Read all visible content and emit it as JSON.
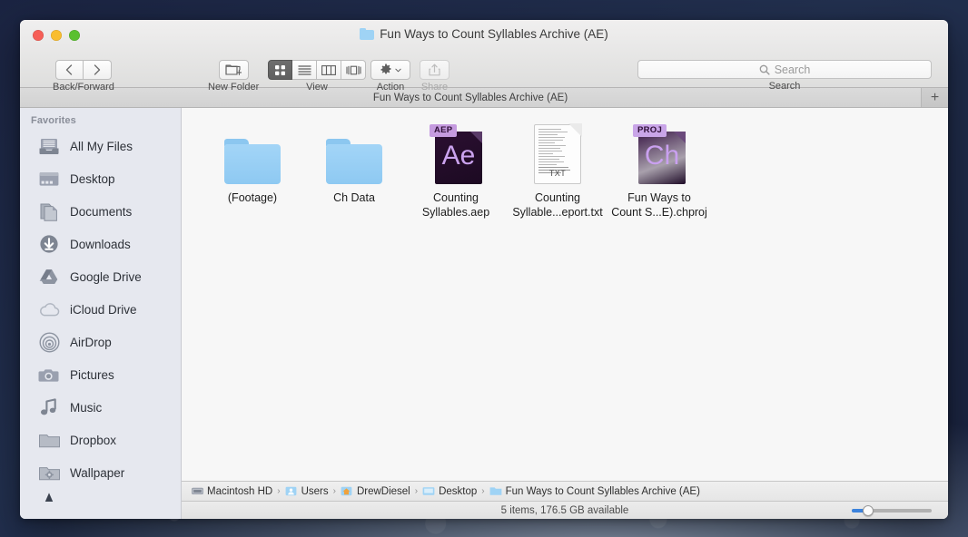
{
  "window": {
    "title": "Fun Ways to Count Syllables Archive (AE)",
    "folder_icon": "folder-icon",
    "traffic_lights": {
      "close": "close-window-button",
      "minimize": "minimize-window-button",
      "zoom": "zoom-window-button"
    }
  },
  "toolbar": {
    "back_label": "‹",
    "forward_label": "›",
    "nav_caption": "Back/Forward",
    "new_folder_caption": "New Folder",
    "view_caption": "View",
    "action_caption": "Action",
    "share_caption": "Share",
    "search_caption": "Search",
    "view_modes": [
      {
        "name": "icon-view",
        "selected": true
      },
      {
        "name": "list-view",
        "selected": false
      },
      {
        "name": "column-view",
        "selected": false
      },
      {
        "name": "coverflow-view",
        "selected": false
      }
    ]
  },
  "search": {
    "placeholder": "Search",
    "value": "",
    "icon": "search-icon"
  },
  "tabbar": {
    "active_tab": "Fun Ways to Count Syllables Archive (AE)",
    "add_tab_label": "+"
  },
  "sidebar": {
    "header": "Favorites",
    "items": [
      {
        "label": "All My Files",
        "icon": "all-my-files-icon"
      },
      {
        "label": "Desktop",
        "icon": "desktop-icon"
      },
      {
        "label": "Documents",
        "icon": "documents-icon"
      },
      {
        "label": "Downloads",
        "icon": "downloads-icon"
      },
      {
        "label": "Google Drive",
        "icon": "google-drive-icon"
      },
      {
        "label": "iCloud Drive",
        "icon": "icloud-drive-icon"
      },
      {
        "label": "AirDrop",
        "icon": "airdrop-icon"
      },
      {
        "label": "Pictures",
        "icon": "pictures-icon"
      },
      {
        "label": "Music",
        "icon": "music-icon"
      },
      {
        "label": "Dropbox",
        "icon": "dropbox-folder-icon"
      },
      {
        "label": "Wallpaper",
        "icon": "wallpaper-folder-icon"
      }
    ]
  },
  "files": [
    {
      "name": "(Footage)",
      "line1": "(Footage)",
      "line2": "",
      "kind": "folder",
      "icon": "folder-icon"
    },
    {
      "name": "Ch Data",
      "line1": "Ch Data",
      "line2": "",
      "kind": "folder",
      "icon": "folder-icon"
    },
    {
      "name": "Counting Syllables.aep",
      "line1": "Counting",
      "line2": "Syllables.aep",
      "kind": "after-effects-project",
      "icon": "after-effects-file-icon",
      "badge": "AEP",
      "glyph": "Ae",
      "badge_color": "#c59bdf",
      "glyph_color": "#cba3ef",
      "body_color": "#22092a"
    },
    {
      "name": "Counting Syllable...eport.txt",
      "line1": "Counting",
      "line2": "Syllable...eport.txt",
      "kind": "plain-text-document",
      "icon": "text-file-icon",
      "badge": "TXT"
    },
    {
      "name": "Fun Ways to Count S...E).chproj",
      "line1": "Fun Ways to",
      "line2": "Count S...E).chproj",
      "kind": "character-animator-project",
      "icon": "character-animator-file-icon",
      "badge": "PROJ",
      "glyph": "Ch",
      "badge_color": "#c9a5e8",
      "glyph_color": "#c9a0ef",
      "body_color": "#2d123a"
    }
  ],
  "pathbar": {
    "crumbs": [
      {
        "label": "Macintosh HD",
        "icon": "hard-drive-icon"
      },
      {
        "label": "Users",
        "icon": "users-folder-icon"
      },
      {
        "label": "DrewDiesel",
        "icon": "home-folder-icon"
      },
      {
        "label": "Desktop",
        "icon": "desktop-folder-icon"
      },
      {
        "label": "Fun Ways to Count Syllables Archive (AE)",
        "icon": "folder-icon"
      }
    ],
    "separator": "›"
  },
  "statusbar": {
    "text": "5 items, 176.5 GB available",
    "zoom_percent": 20
  },
  "colors": {
    "accent_blue": "#3b82dc",
    "folder_blue": "#8ec9f2",
    "sidebar_bg": "#e6e8ef",
    "desktop": "#1e2a4a"
  }
}
